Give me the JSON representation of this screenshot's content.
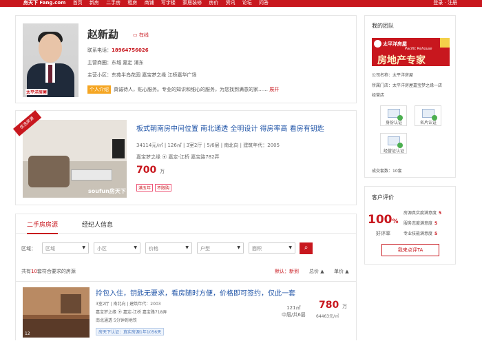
{
  "topbar": {
    "logo": "房天下 Fang.com",
    "links": [
      "首页",
      "新房",
      "二手房",
      "租房",
      "商铺",
      "写字楼",
      "家居装修",
      "房价",
      "资讯",
      "论坛",
      "问答"
    ],
    "right": "登录 · 注册"
  },
  "profile": {
    "name": "赵新勐",
    "chat": "在线",
    "photo_badge": "太平洋房屋",
    "phone_label": "联系电话：",
    "phone": "18964756026",
    "area_label": "主营商圈：",
    "area": "东城  嘉定  浦东",
    "community_label": "主营小区：",
    "community": "东苑半岛花园  嘉宝梦之缘  江桥嘉华广场",
    "intro_tag": "个人介绍",
    "intro": "真诚待人，贴心服务。专业的知识和细心的服务，为您找到满意的家……",
    "intro_more": "展开"
  },
  "listing": {
    "ribbon": "优选房源",
    "title": "板式朝南房中间位置 南北通透 全明设计 得房率高 看房有钥匙",
    "meta": "34114元/㎡  |  126㎡  |  3室2厅  |  5/6层  |  南北向  |  建筑年代：2005",
    "community": "嘉宝梦之缘  ⦿  嘉定-江桥  嘉宝路782弄",
    "price": "700",
    "price_unit": "万",
    "tags": [
      "满五年",
      "不限购"
    ],
    "watermark": "soufun房天下"
  },
  "tabs": [
    "二手房房源",
    "经纪人信息"
  ],
  "filters": {
    "label": "区域：",
    "selects": [
      "区域",
      "小区",
      "价格",
      "户型",
      "面积"
    ],
    "search_icon": "search-icon"
  },
  "results": {
    "count_pre": "共有",
    "count": "10",
    "count_post": "套符合要求的房源",
    "sorts": [
      "默认：新到",
      "总价 ▲",
      "单价 ▲"
    ]
  },
  "item": {
    "title": "拎包入住，钥匙无要求，看房随时方便，价格即可签约，仅此一套",
    "meta": "3室2厅  |  南北向  |  建筑年代：2003",
    "community": "嘉宝梦之缘  ⦿  嘉定-江桥  嘉宝路718弄",
    "tag": "南北通透  5分钟到地铁",
    "verify": "房天下认证：真实房源1年1056天",
    "area": "121㎡",
    "floor": "中层/共6层",
    "price": "780",
    "price_unit": "万",
    "unit_price": "64463元/㎡",
    "photo_num": "12"
  },
  "shop": {
    "title": "我的团队",
    "logo_line1": "太平洋房屋",
    "logo_line2": "Pacific Rehouse",
    "logo_line3": "房地产专家",
    "company_label": "公司名称：",
    "company": "太平洋房屋",
    "store_label": "所属门店：",
    "store": "太平洋房屋嘉宝梦之缘一店",
    "store_tail": "经营店",
    "certs": [
      "身份认证",
      "名片认证",
      "经营证认证"
    ],
    "deals_label": "成交套数：",
    "deals": "10套"
  },
  "review": {
    "title": "客户评价",
    "pct": "100",
    "pct_unit": "%",
    "pct_label": "好评率",
    "rows": [
      {
        "label": "房源真实度满意度",
        "score": "5"
      },
      {
        "label": "服务态度满意度",
        "score": "5"
      },
      {
        "label": "专业技能满意度",
        "score": "5"
      }
    ],
    "button": "我来点评TA"
  }
}
